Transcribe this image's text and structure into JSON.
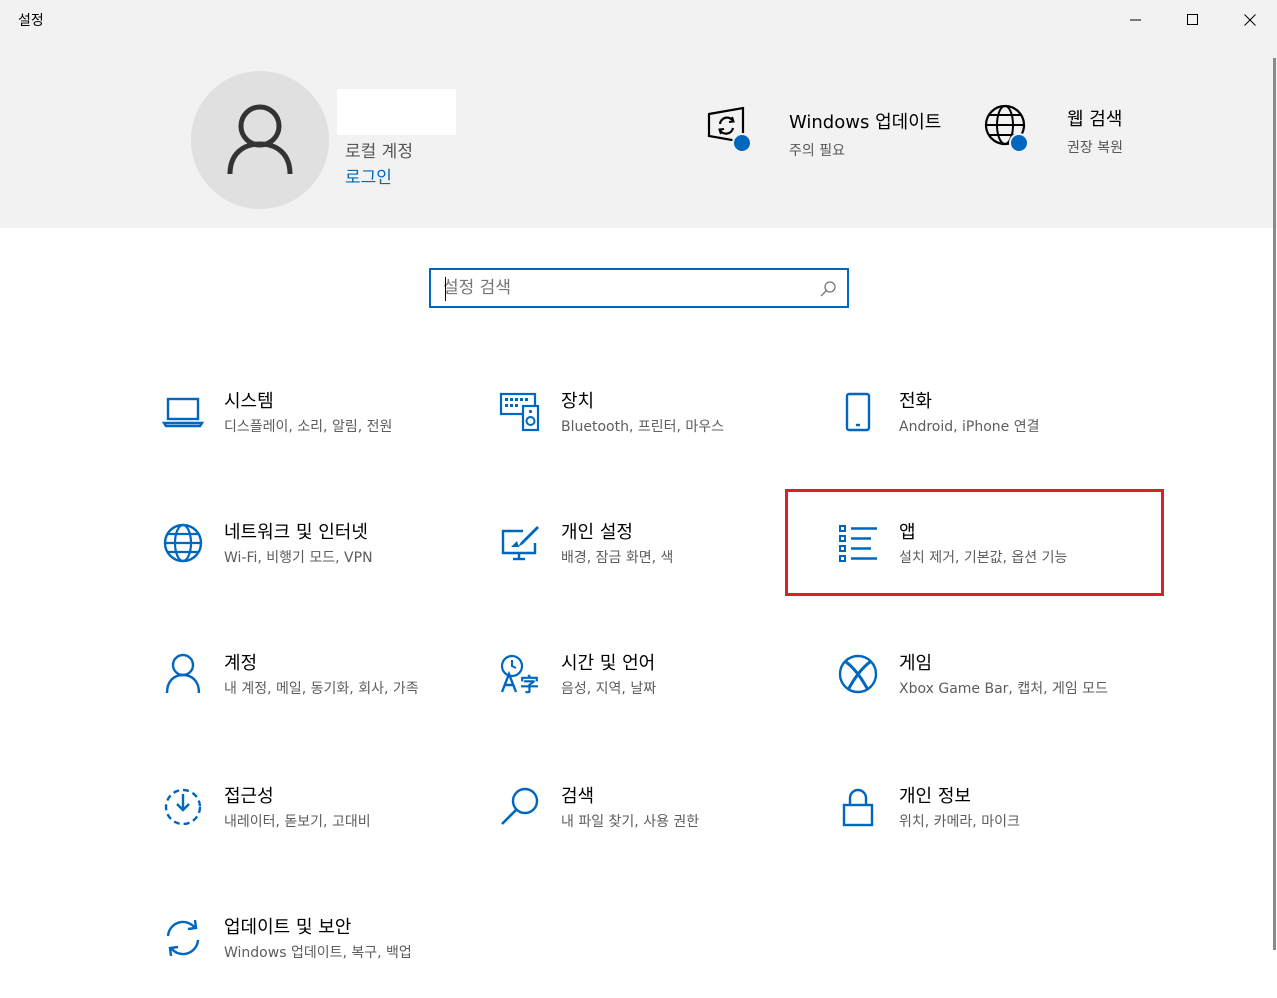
{
  "window": {
    "title": "설정",
    "minimize_icon": "minimize-icon",
    "maximize_icon": "maximize-icon",
    "close_icon": "close-icon"
  },
  "header": {
    "account_type": "로컬 계정",
    "login_link": "로그인",
    "quick_links": [
      {
        "title": "Windows 업데이트",
        "subtitle": "주의 필요",
        "icon": "windows-update-icon"
      },
      {
        "title": "웹 검색",
        "subtitle": "권장 복원",
        "icon": "web-search-globe-icon"
      }
    ]
  },
  "search": {
    "placeholder": "설정 검색"
  },
  "tiles": [
    {
      "title": "시스템",
      "subtitle": "디스플레이, 소리, 알림, 전원",
      "icon": "laptop-icon"
    },
    {
      "title": "장치",
      "subtitle": "Bluetooth, 프린터, 마우스",
      "icon": "keyboard-speaker-icon"
    },
    {
      "title": "전화",
      "subtitle": "Android, iPhone 연결",
      "icon": "phone-icon"
    },
    {
      "title": "네트워크 및 인터넷",
      "subtitle": "Wi-Fi, 비행기 모드, VPN",
      "icon": "globe-icon"
    },
    {
      "title": "개인 설정",
      "subtitle": "배경, 잠금 화면, 색",
      "icon": "personalization-brush-icon"
    },
    {
      "title": "앱",
      "subtitle": "설치 제거, 기본값, 옵션 기능",
      "icon": "apps-list-icon"
    },
    {
      "title": "계정",
      "subtitle": "내 계정, 메일, 동기화, 회사, 가족",
      "icon": "person-icon"
    },
    {
      "title": "시간 및 언어",
      "subtitle": "음성, 지역, 날짜",
      "icon": "time-language-icon"
    },
    {
      "title": "게임",
      "subtitle": "Xbox Game Bar, 캡처, 게임 모드",
      "icon": "xbox-icon"
    },
    {
      "title": "접근성",
      "subtitle": "내레이터, 돋보기, 고대비",
      "icon": "ease-of-access-icon"
    },
    {
      "title": "검색",
      "subtitle": "내 파일 찾기, 사용 권한",
      "icon": "magnifier-icon"
    },
    {
      "title": "개인 정보",
      "subtitle": "위치, 카메라, 마이크",
      "icon": "lock-icon"
    },
    {
      "title": "업데이트 및 보안",
      "subtitle": "Windows 업데이트, 복구, 백업",
      "icon": "sync-arrows-icon"
    }
  ],
  "colors": {
    "accent": "#0067c0",
    "header_bg": "#f2f2f2",
    "highlight_box": "#d6202a"
  }
}
